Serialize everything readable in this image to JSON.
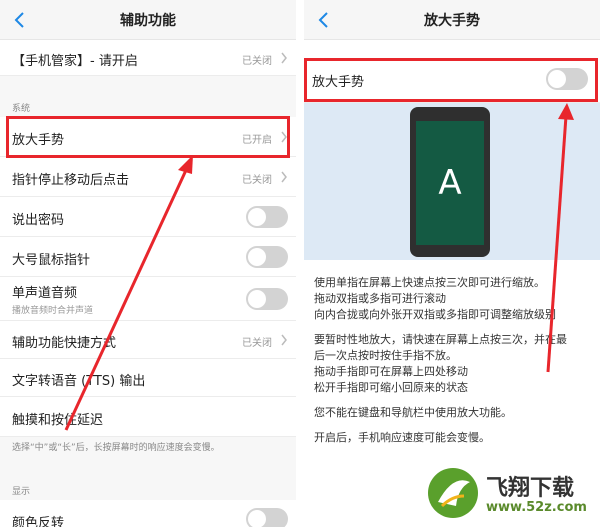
{
  "left": {
    "title": "辅助功能",
    "top_row": {
      "label": "【手机管家】- 请开启",
      "status": "已关闭"
    },
    "section_system": "系统",
    "rows": {
      "magnify": {
        "label": "放大手势",
        "status": "已开启"
      },
      "pointer_click": {
        "label": "指针停止移动后点击",
        "status": "已关闭"
      },
      "speak_password": {
        "label": "说出密码"
      },
      "large_pointer": {
        "label": "大号鼠标指针"
      },
      "mono_audio": {
        "label": "单声道音频",
        "sub": "播放音频时合并声道"
      },
      "shortcut": {
        "label": "辅助功能快捷方式",
        "status": "已关闭"
      },
      "tts": {
        "label": "文字转语音 (TTS) 输出"
      },
      "touch_delay": {
        "label": "触摸和按住延迟"
      }
    },
    "touch_delay_note": "选择“中”或“长”后，长按屏幕时的响应速度会变慢。",
    "section_display": "显示",
    "color_invert": {
      "label": "颜色反转"
    }
  },
  "right": {
    "title": "放大手势",
    "gesture_label": "放大手势",
    "phone_letter": "A",
    "desc": [
      "使用单指在屏幕上快速点按三次即可进行缩放。",
      "拖动双指或多指可进行滚动",
      "向内合拢或向外张开双指或多指即可调整缩放级别",
      "要暂时性地放大，请快速在屏幕上点按三次，并在最",
      "后一次点按时按住手指不放。",
      "拖动手指即可在屏幕上四处移动",
      "松开手指即可缩小回原来的状态",
      "您不能在键盘和导航栏中使用放大功能。",
      "开启后，手机响应速度可能会变慢。"
    ]
  },
  "watermark": {
    "name": "飞翔下载",
    "url": "www.52z.com"
  },
  "colors": {
    "highlight": "#e8262c",
    "accent": "#1e88e5",
    "phone_screen": "#145a43"
  }
}
